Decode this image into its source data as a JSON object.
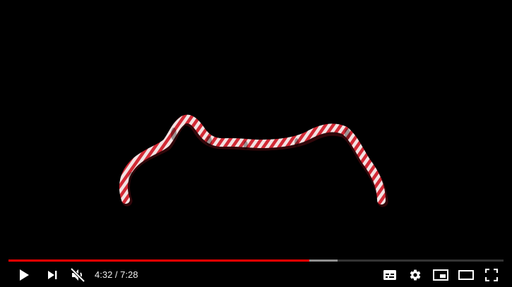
{
  "player": {
    "time": {
      "current": "4:32",
      "separator": " / ",
      "duration": "7:28"
    },
    "progress": {
      "played_fraction": 0.608,
      "buffered_fraction": 0.665
    },
    "colors": {
      "accent": "#ff0000",
      "icon": "#ffffff",
      "ribbon_red": "#d22a35",
      "ribbon_white": "#f4e6e6"
    },
    "controls": {
      "left": [
        "play-icon",
        "next-icon",
        "volume-muted-icon"
      ],
      "right": [
        "subtitles-icon",
        "gear-icon",
        "miniplayer-icon",
        "theater-mode-icon",
        "fullscreen-icon"
      ]
    }
  }
}
